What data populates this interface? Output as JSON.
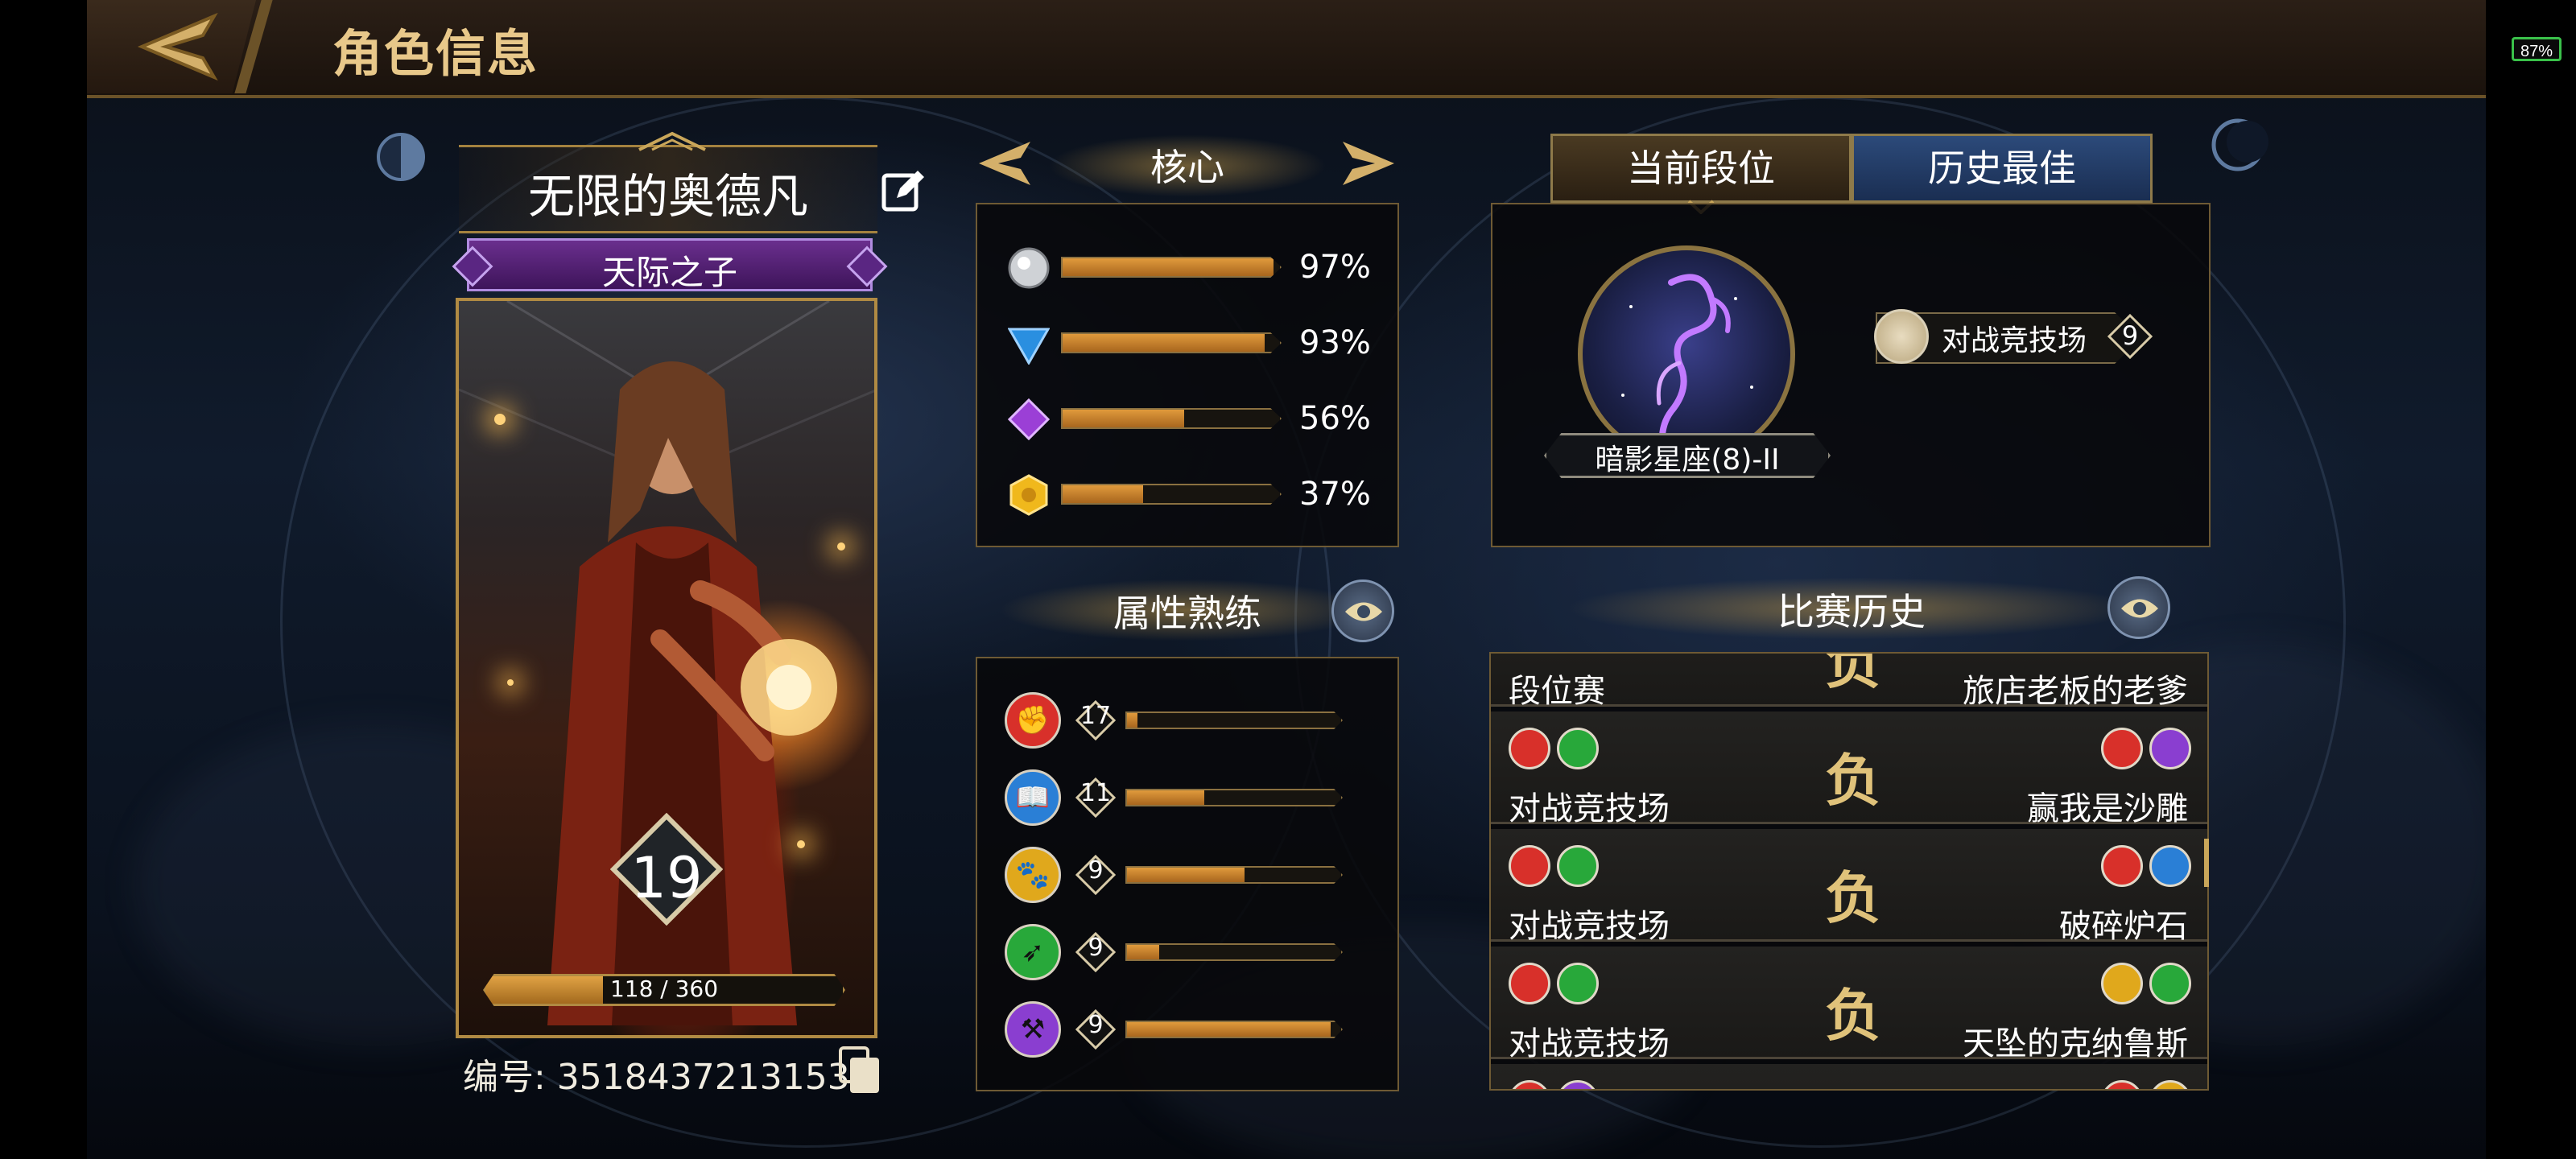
{
  "header": {
    "title": "角色信息",
    "battery": "87%"
  },
  "player": {
    "name": "无限的奥德凡",
    "title": "天际之子",
    "level": "19",
    "xp_text": "118 / 360",
    "xp_progress": 0.328,
    "id_text": "编号: 35184372131538"
  },
  "core": {
    "title": "核心",
    "rows": [
      {
        "icon": "silver-orb-icon",
        "pct_text": "97%",
        "value": 97
      },
      {
        "icon": "blue-gem-icon",
        "pct_text": "93%",
        "value": 93
      },
      {
        "icon": "purple-gem-icon",
        "pct_text": "56%",
        "value": 56
      },
      {
        "icon": "gold-hex-icon",
        "pct_text": "37%",
        "value": 37
      }
    ]
  },
  "attributes": {
    "title": "属性熟练",
    "rows": [
      {
        "icon": "red-fist-icon",
        "color": "#d8302a",
        "level": "17",
        "progress": 0.05
      },
      {
        "icon": "blue-book-icon",
        "color": "#2a7fd6",
        "level": "11",
        "progress": 0.36
      },
      {
        "icon": "yellow-beast-icon",
        "color": "#e0a81c",
        "level": "9",
        "progress": 0.55
      },
      {
        "icon": "green-arrow-icon",
        "color": "#28a83a",
        "level": "9",
        "progress": 0.15
      },
      {
        "icon": "purple-anvil-icon",
        "color": "#8a3ed0",
        "level": "9",
        "progress": 0.95
      }
    ]
  },
  "rank": {
    "tab_current": "当前段位",
    "tab_best": "历史最佳",
    "rank_name": "暗影星座(8)-II",
    "arena_label": "对战竞技场",
    "arena_count": "9"
  },
  "history": {
    "title": "比赛历史",
    "matches": [
      {
        "mode": "段位赛",
        "result": "负",
        "opponent": "旅店老板的老爹"
      },
      {
        "mode": "对战竞技场",
        "result": "负",
        "opponent": "赢我是沙雕"
      },
      {
        "mode": "对战竞技场",
        "result": "负",
        "opponent": "破碎炉石"
      },
      {
        "mode": "对战竞技场",
        "result": "负",
        "opponent": "天坠的克纳鲁斯"
      }
    ]
  },
  "colors": {
    "accent_gold": "#c9a65a",
    "title_gold": "#e8c88a",
    "banner_purple": "#6a2f8e"
  }
}
